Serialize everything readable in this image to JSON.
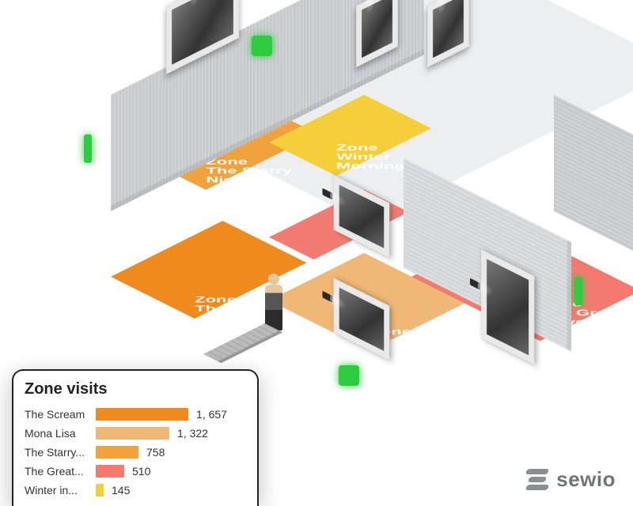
{
  "brand": "sewio",
  "zones": {
    "starry": {
      "label": "Zone\nThe Starry\nNight",
      "color": "#f0a23c"
    },
    "scream": {
      "label": "Zone\nThe Scream",
      "color": "#ef8a1f"
    },
    "mona": {
      "label": "Zone\nMona Lisa",
      "color": "#f0b877"
    },
    "wave": {
      "label": "Zone\nThe Great\nWave Off\nKanagawa",
      "color": "#f47a6f"
    },
    "winter": {
      "label": "Zone\nWinter\nMorning",
      "color": "#f4cf3a"
    },
    "blank": {
      "label": "",
      "color": "#f37c72"
    }
  },
  "chart_data": {
    "type": "bar",
    "title": "Zone visits",
    "xlabel": "",
    "ylabel": "",
    "categories": [
      "The Scream",
      "Mona Lisa",
      "The Starry...",
      "The Great...",
      "Winter in..."
    ],
    "values": [
      1657,
      1322,
      758,
      510,
      145
    ],
    "value_labels": [
      "1, 657",
      "1, 322",
      "758",
      "510",
      "145"
    ],
    "colors": [
      "#ef8a1f",
      "#f0b877",
      "#f0a23c",
      "#f47a6f",
      "#f4cf3a"
    ],
    "xlim": [
      0,
      1700
    ]
  }
}
